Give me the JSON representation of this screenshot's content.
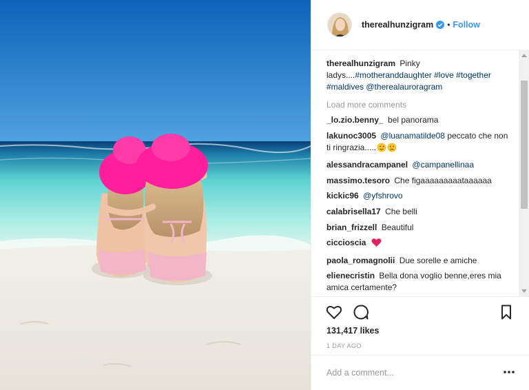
{
  "header": {
    "username": "therealhunzigram",
    "separator": "•",
    "follow_label": "Follow"
  },
  "caption": {
    "username": "therealhunzigram",
    "text_prefix": "Pinky ladys....",
    "tags": [
      "#motheranddaughter",
      "#love",
      "#together",
      "#maldives",
      "@therealauroragram"
    ]
  },
  "load_more": "Load more comments",
  "comments": [
    {
      "user": "_lo.zio.benny_",
      "text": "bel panorama"
    },
    {
      "user": "lakunoc3005",
      "mention": "@luanamatilde08",
      "text": "peccato che non ti ringrazia....."
    },
    {
      "user": "alessandracampanel",
      "mention": "@campanellinaa",
      "text": ""
    },
    {
      "user": "massimo.tesoro",
      "text": "Che figaaaaaaaaataaaaaa"
    },
    {
      "user": "kickic96",
      "mention": "@yfshrovo",
      "text": ""
    },
    {
      "user": "calabrisella17",
      "text": "Che belli"
    },
    {
      "user": "brian_frizzell",
      "text": "Beautiful"
    },
    {
      "user": "ciccioscia",
      "text": ""
    },
    {
      "user": "paola_romagnolii",
      "text": "Due sorelle e amiche"
    },
    {
      "user": "elienecristin",
      "text": "Bella dona voglio benne,eres mia amica certamente?"
    }
  ],
  "likes_text": "131,417 likes",
  "timestamp": "1 DAY AGO",
  "add_comment": {
    "placeholder": "Add a comment..."
  },
  "icons": {
    "like": "heart-icon",
    "comment": "comment-icon",
    "save": "bookmark-icon",
    "more": "more-options-icon",
    "verified": "verified-badge-icon"
  },
  "colors": {
    "link": "#3897f0",
    "hashtag": "#003569",
    "muted": "#999999",
    "text": "#262626",
    "heart_emoji": "#e0245e",
    "hat": "#ff1e9c"
  }
}
